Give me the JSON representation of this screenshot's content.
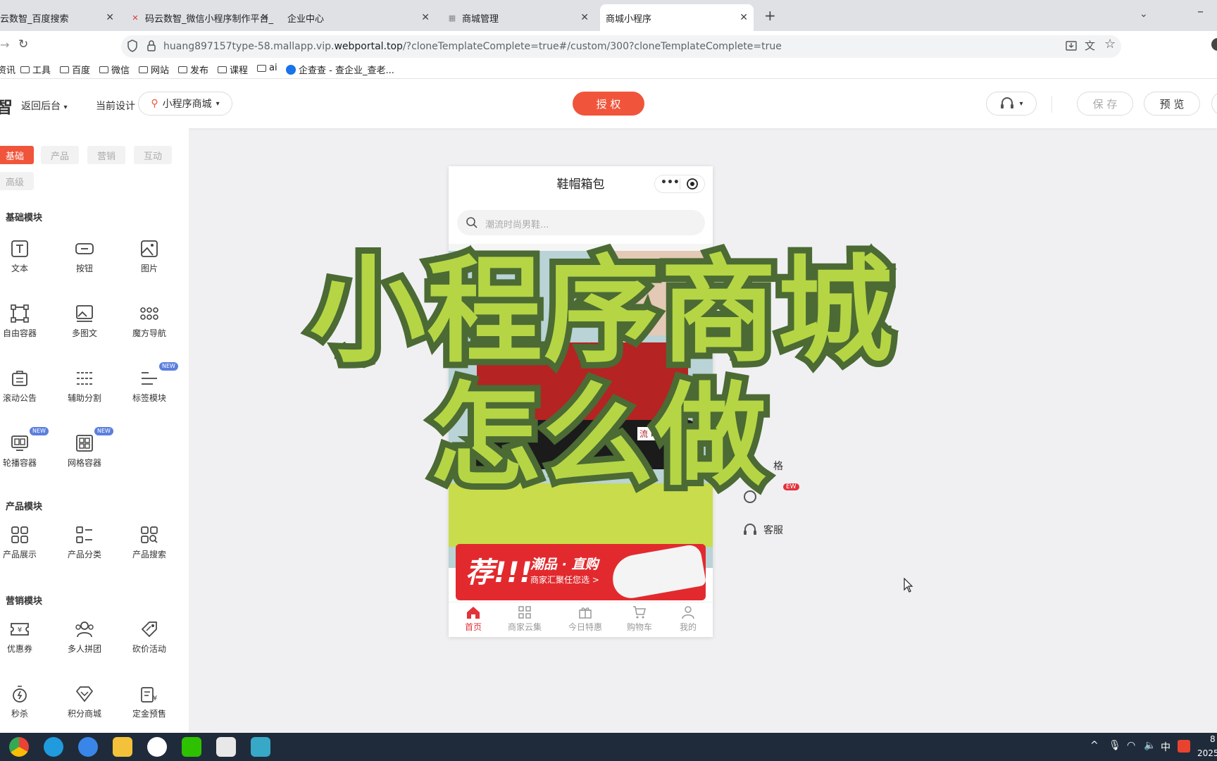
{
  "browser": {
    "tabs": [
      {
        "title": "云数智_百度搜索",
        "active": false
      },
      {
        "title": "码云数智_微信小程序制作平台_",
        "active": false
      },
      {
        "title": "企业中心",
        "active": false
      },
      {
        "title": "商城管理",
        "active": false
      },
      {
        "title": "商城小程序",
        "active": true
      }
    ],
    "new_tab": "+",
    "url_prefix": "huang897157type-58.mallapp.vip.",
    "url_domain": "webportal.top",
    "url_suffix": "/?cloneTemplateComplete=true#/custom/300?cloneTemplateComplete=true",
    "bookmarks": [
      "资讯",
      "工具",
      "百度",
      "微信",
      "网站",
      "发布",
      "课程",
      "ai",
      "企查查 - 查企业_查老..."
    ]
  },
  "app": {
    "logo_char": "智",
    "back_label": "返回后台",
    "current_design_label": "当前设计",
    "current_design_value": "小程序商城",
    "auth_label": "授 权",
    "save_label": "保 存",
    "preview_label": "预 览",
    "accent": "#f0553b"
  },
  "sidebar": {
    "categories": [
      "基础",
      "产品",
      "营销",
      "互动",
      "高级"
    ],
    "active_category": "基础",
    "basic_title": "基础模块",
    "basic_items": [
      "文本",
      "按钮",
      "图片",
      "自由容器",
      "多图文",
      "魔方导航",
      "滚动公告",
      "辅助分割",
      "标签模块",
      "轮播容器",
      "网格容器"
    ],
    "new_badge": "NEW",
    "product_title": "产品模块",
    "product_items": [
      "产品展示",
      "产品分类",
      "产品搜索"
    ],
    "marketing_title": "营销模块",
    "marketing_items": [
      "优惠券",
      "多人拼团",
      "砍价活动",
      "秒杀",
      "积分商城",
      "定金预售"
    ]
  },
  "phone": {
    "title": "鞋帽箱包",
    "search_placeholder": "潮流时尚男鞋...",
    "banner_big": "荐!!!",
    "banner_line1": "潮品 · 直购",
    "banner_line2": "商家汇聚任您选 >",
    "banner_tag": "流 时",
    "nav": [
      "首页",
      "商家云集",
      "今日特惠",
      "购物车",
      "我的"
    ]
  },
  "right_panel": {
    "item_style": "格",
    "item_new": "EW",
    "service": "客服"
  },
  "overlay": {
    "line1": "小程序商城",
    "line2": "怎么做"
  },
  "taskbar": {
    "ime": "中",
    "year_frag": "2025",
    "time_frag": "8"
  }
}
